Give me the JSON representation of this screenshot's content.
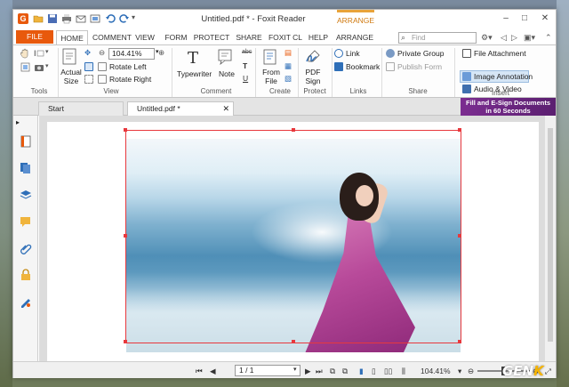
{
  "window": {
    "title": "Untitled.pdf * - Foxit Reader",
    "context_tab": "ARRANGE",
    "controls": [
      "–",
      "□",
      "✕"
    ]
  },
  "quick_access": {
    "app_icon": "foxit-logo-icon",
    "app_letter": "G",
    "buttons": [
      "open-icon",
      "save-icon",
      "print-icon",
      "email-icon",
      "undo-icon",
      "redo-icon",
      "customize-icon"
    ]
  },
  "ribbon_tabs": {
    "file": "FILE",
    "items": [
      "HOME",
      "COMMENT",
      "VIEW",
      "FORM",
      "PROTECT",
      "SHARE",
      "FOXIT CL",
      "HELP",
      "ARRANGE"
    ],
    "active": "HOME",
    "find_placeholder": "Find"
  },
  "ribbon": {
    "tools": {
      "label": "Tools"
    },
    "view": {
      "label": "View",
      "actual_size": "Actual Size",
      "actual_size_line1": "Actual",
      "actual_size_line2": "Size",
      "zoom_value": "104.41%",
      "rotate_left": "Rotate Left",
      "rotate_right": "Rotate Right"
    },
    "comment": {
      "label": "Comment",
      "typewriter": "Typewriter",
      "note": "Note",
      "abc_icon_text": "abc"
    },
    "create": {
      "label": "Create",
      "from_file_line1": "From",
      "from_file_line2": "File"
    },
    "protect": {
      "label": "Protect",
      "pdf_sign_line1": "PDF",
      "pdf_sign_line2": "Sign"
    },
    "links": {
      "label": "Links",
      "link": "Link",
      "bookmark": "Bookmark"
    },
    "share": {
      "label": "Share",
      "private_group": "Private Group",
      "publish_form": "Publish Form"
    },
    "insert": {
      "label": "Insert",
      "file_attachment": "File Attachment",
      "image_annotation": "Image Annotation",
      "audio_video": "Audio & Video"
    }
  },
  "doc_tabs": {
    "start": "Start",
    "current": "Untitled.pdf *",
    "promo_line1": "Fill and E-Sign Documents",
    "promo_line2": "in 60 Seconds"
  },
  "sidebar_icons": [
    "page-thumbnail-icon",
    "pages-icon",
    "layers-icon",
    "comments-icon",
    "attachments-icon",
    "security-icon",
    "signature-icon"
  ],
  "statusbar": {
    "page_indicator": "1 / 1",
    "zoom": "104.41%"
  },
  "watermark": {
    "text": "GEN",
    "accent": "K"
  },
  "colors": {
    "accent": "#e8590c",
    "selection": "#e8383d",
    "arrange": "#e8a33a",
    "promo": "#7b2d90"
  }
}
